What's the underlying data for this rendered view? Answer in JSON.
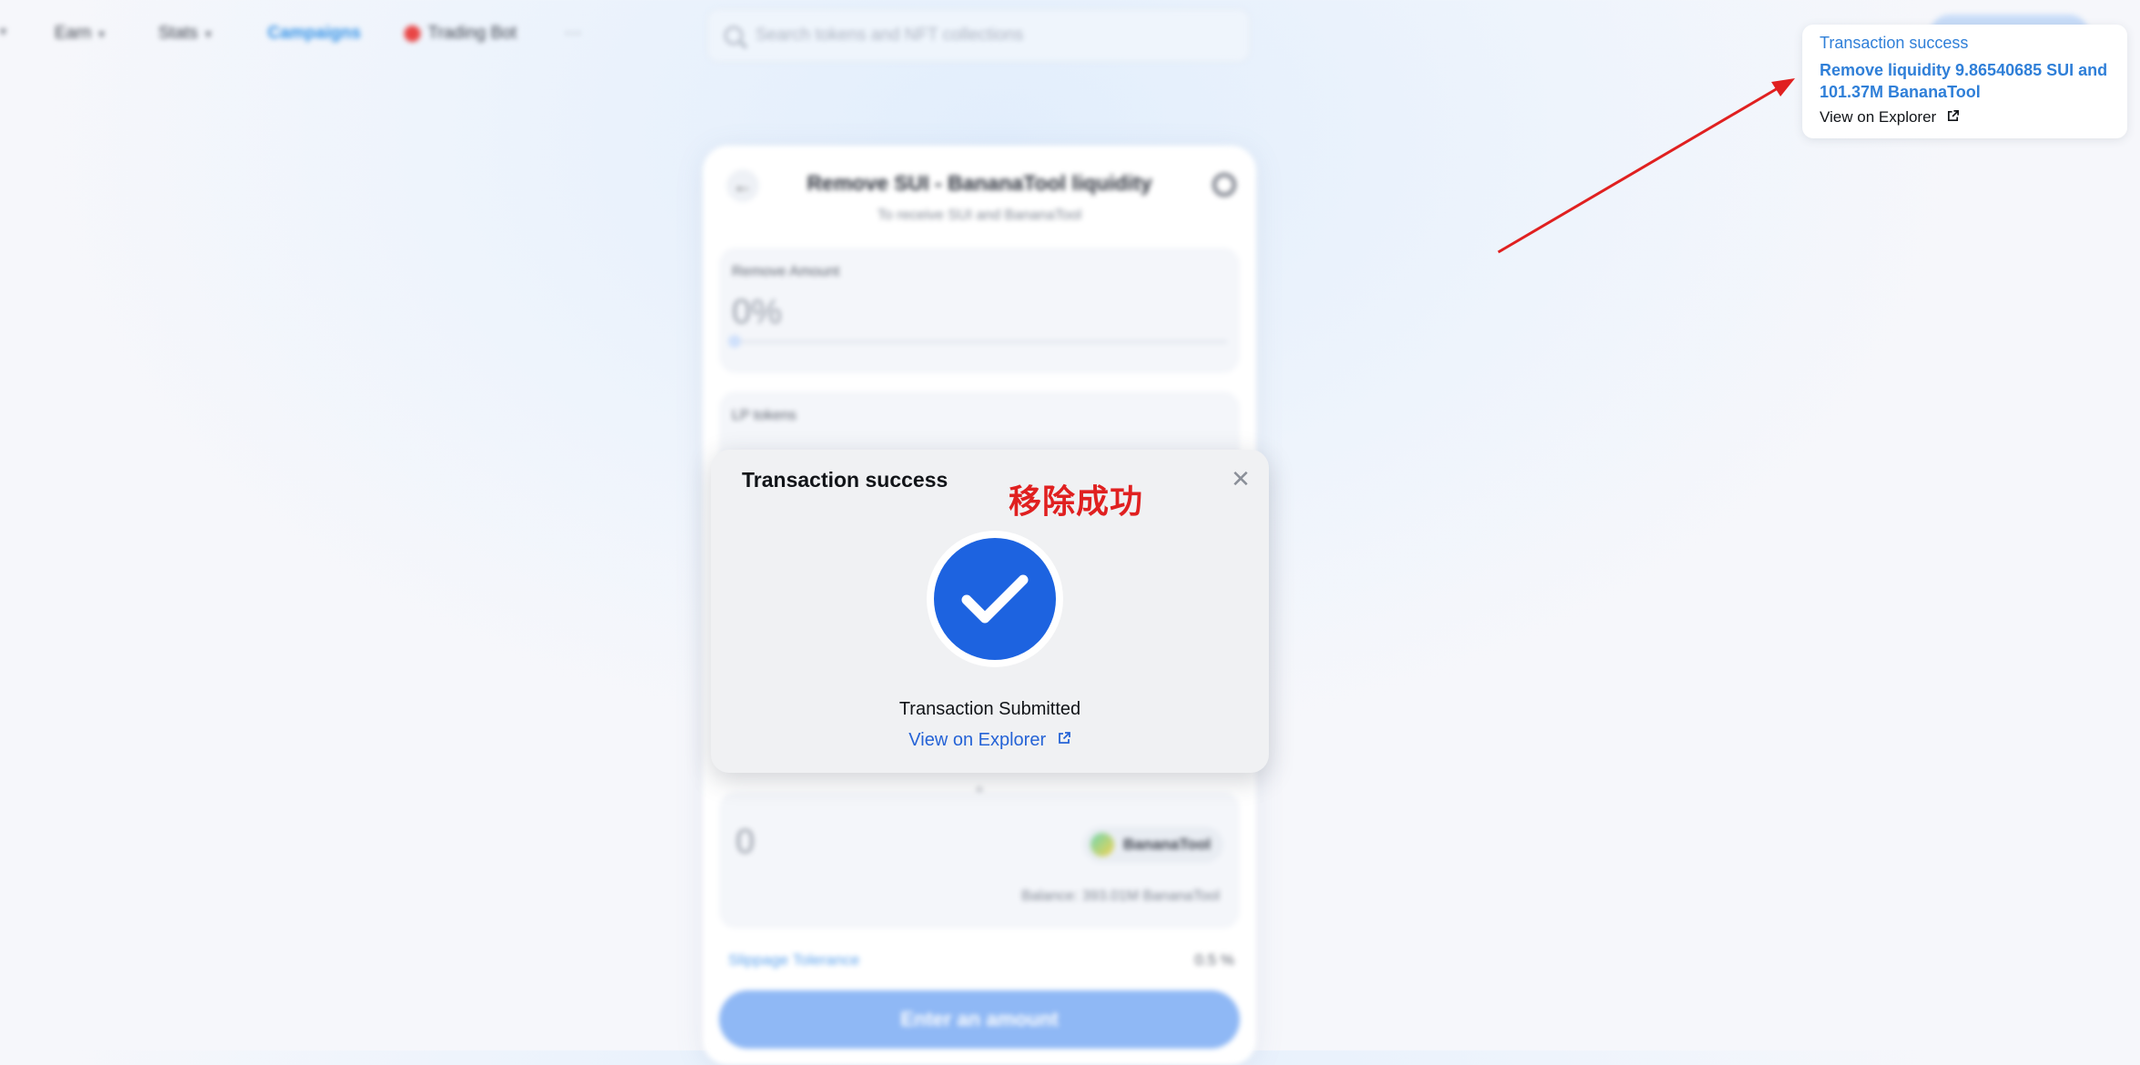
{
  "nav": {
    "items": [
      {
        "label": "Earn",
        "has_dropdown": true
      },
      {
        "label": "Stats",
        "has_dropdown": true
      },
      {
        "label": "Campaigns",
        "active": true
      },
      {
        "label": "Trading Bot"
      }
    ],
    "more_label": "···",
    "search_placeholder": "Search tokens and NFT collections"
  },
  "card": {
    "title": "Remove SUI - BananaTool liquidity",
    "subtitle": "To receive SUI and BananaTool",
    "remove_amount_label": "Remove Amount",
    "remove_amount_value": "0%",
    "lp_label": "LP tokens",
    "output_value": "0",
    "output_token": "BananaTool",
    "balance_text": "Balance: 393.01M BananaTool",
    "plus_mark": "+",
    "slippage_label": "Slippage Tolerance",
    "slippage_value": "0.5 %",
    "enter_button": "Enter an amount"
  },
  "modal": {
    "title": "Transaction success",
    "status": "Transaction Submitted",
    "link": "View on Explorer",
    "close_glyph": "✕"
  },
  "toast": {
    "title": "Transaction success",
    "message": "Remove liquidity 9.86540685 SUI and 101.37M BananaTool",
    "link": "View on Explorer"
  },
  "annotation": {
    "text": "移除成功",
    "color": "#e02020"
  },
  "colors": {
    "accent": "#1d63e0",
    "link": "#2563d6",
    "toast_accent": "#2f7fd8"
  }
}
